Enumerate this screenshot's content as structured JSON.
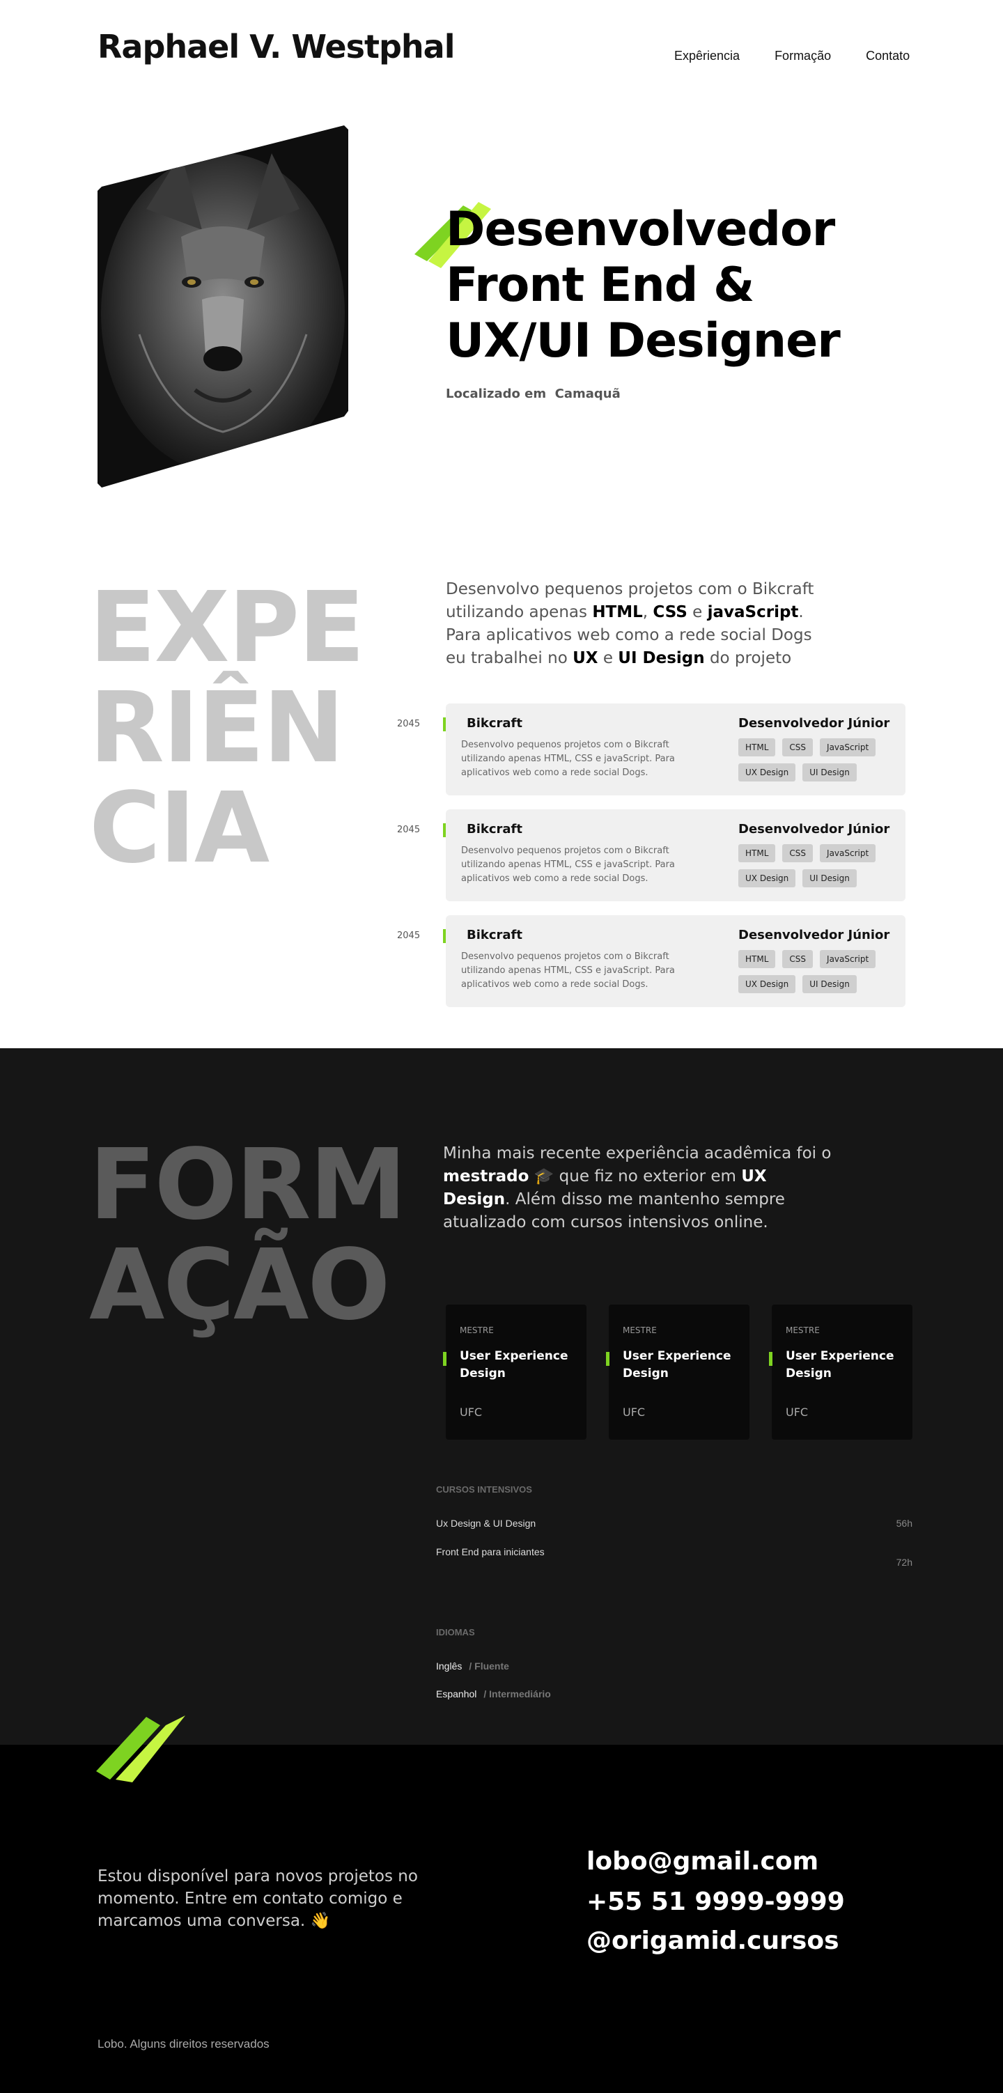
{
  "header": {
    "brand": "Raphael V. Westphal",
    "nav": [
      "Expêriencia",
      "Formação",
      "Contato"
    ]
  },
  "hero": {
    "photo_alt": "wolf-photo",
    "title": "Desenvolvedor\nFront End &\nUX/UI Designer",
    "location_label": "Localizado em",
    "location_city": "Camaquã"
  },
  "experience": {
    "heading": "EXPE\nRIÊN\nCIA",
    "intro_parts": [
      "Desenvolvo pequenos projetos com o Bikcraft utilizando apenas ",
      "HTML",
      ", ",
      "CSS",
      " e ",
      "javaScript",
      ". Para aplicativos web como a rede social Dogs eu trabalhei no ",
      "UX",
      " e ",
      "UI Design",
      " do projeto"
    ],
    "items": [
      {
        "year": "2045",
        "company": "Bikcraft",
        "description": "Desenvolvo pequenos projetos com o Bikcraft utilizando apenas HTML, CSS e javaScript. Para aplicativos web como a rede social Dogs.",
        "role": "Desenvolvedor Júnior",
        "tags": [
          "HTML",
          "CSS",
          "JavaScript",
          "UX Design",
          "UI Design"
        ]
      },
      {
        "year": "2045",
        "company": "Bikcraft",
        "description": "Desenvolvo pequenos projetos com o Bikcraft utilizando apenas HTML, CSS e javaScript. Para aplicativos web como a rede social Dogs.",
        "role": "Desenvolvedor Júnior",
        "tags": [
          "HTML",
          "CSS",
          "JavaScript",
          "UX Design",
          "UI Design"
        ]
      },
      {
        "year": "2045",
        "company": "Bikcraft",
        "description": "Desenvolvo pequenos projetos com o Bikcraft utilizando apenas HTML, CSS e javaScript. Para aplicativos web como a rede social Dogs.",
        "role": "Desenvolvedor Júnior",
        "tags": [
          "HTML",
          "CSS",
          "JavaScript",
          "UX Design",
          "UI Design"
        ]
      }
    ]
  },
  "education": {
    "heading": "FORM\nAÇÃO",
    "intro_parts": [
      "Minha mais recente experiência acadêmica foi o ",
      "mestrado",
      " 🎓 que fiz no exterior em ",
      "UX Design",
      ". Além disso me mantenho sempre atualizado com cursos intensivos online."
    ],
    "cards": [
      {
        "level": "MESTRE",
        "title": "User Experience Design",
        "institution": "UFC"
      },
      {
        "level": "MESTRE",
        "title": "User Experience Design",
        "institution": "UFC"
      },
      {
        "level": "MESTRE",
        "title": "User Experience Design",
        "institution": "UFC"
      }
    ],
    "courses_label": "CURSOS INTENSIVOS",
    "courses": [
      {
        "name": "Ux Design & UI Design",
        "hours": "56h"
      },
      {
        "name": "Front End para iniciantes",
        "hours": "72h"
      }
    ],
    "languages_label": "IDIOMAS",
    "languages": [
      {
        "name": "Inglês",
        "level": "/ Fluente"
      },
      {
        "name": "Espanhol",
        "level": "/ Intermediário"
      }
    ]
  },
  "footer": {
    "text": "Estou disponível para novos projetos no momento. Entre em contato comigo e marcamos uma conversa. 👋",
    "email": "lobo@gmail.com",
    "phone": "+55 51 9999-9999",
    "social": "@origamid.cursos",
    "copyright": "Lobo. Alguns direitos reservados"
  },
  "colors": {
    "accent": "#7ed321",
    "accent_light": "#c6f542",
    "dark_bg": "#161616",
    "footer_bg": "#000000"
  }
}
